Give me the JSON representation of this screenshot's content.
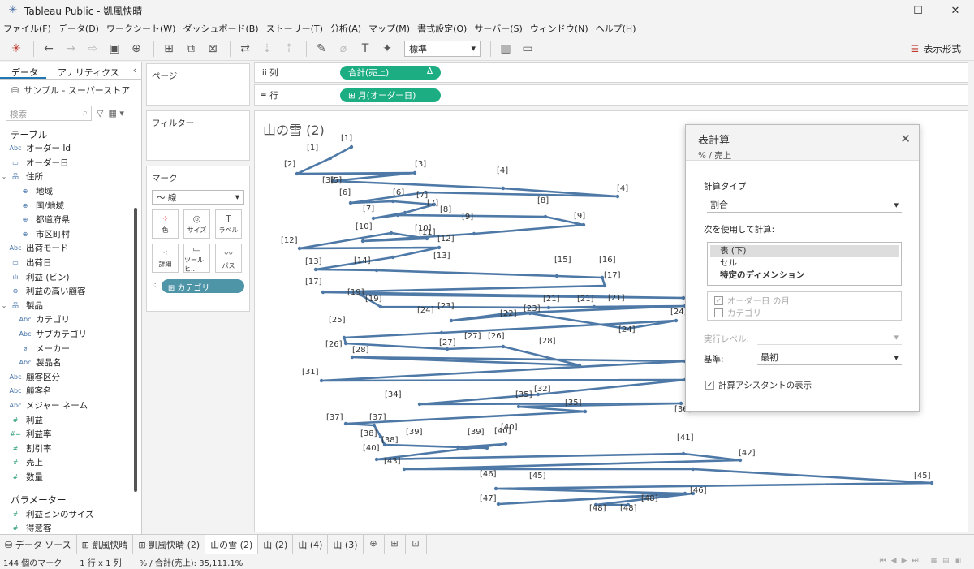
{
  "window": {
    "title": "Tableau Public - 凱風快晴"
  },
  "menu": [
    "ファイル(F)",
    "データ(D)",
    "ワークシート(W)",
    "ダッシュボード(B)",
    "ストーリー(T)",
    "分析(A)",
    "マップ(M)",
    "書式設定(O)",
    "サーバー(S)",
    "ウィンドウ(N)",
    "ヘルプ(H)"
  ],
  "toolbar": {
    "fit": "標準",
    "show_me": "表示形式"
  },
  "datapane": {
    "tab_data": "データ",
    "tab_analytics": "アナリティクス",
    "datasource": "サンプル - スーパーストア",
    "search_placeholder": "検索",
    "tables_header": "テーブル",
    "fields": [
      {
        "name": "オーダー Id",
        "icon": "Abc",
        "indent": 0
      },
      {
        "name": "オーダー日",
        "icon": "date",
        "indent": 0
      },
      {
        "name": "住所",
        "icon": "hier",
        "indent": 0,
        "expand": true
      },
      {
        "name": "地域",
        "icon": "geo",
        "indent": 1
      },
      {
        "name": "国/地域",
        "icon": "geo",
        "indent": 1
      },
      {
        "name": "都道府県",
        "icon": "geo",
        "indent": 1
      },
      {
        "name": "市区町村",
        "icon": "geo",
        "indent": 1
      },
      {
        "name": "出荷モード",
        "icon": "Abc",
        "indent": 0
      },
      {
        "name": "出荷日",
        "icon": "date",
        "indent": 0
      },
      {
        "name": "利益 (ビン)",
        "icon": "bin",
        "indent": 0
      },
      {
        "name": "利益の高い顧客",
        "icon": "set",
        "indent": 0
      },
      {
        "name": "製品",
        "icon": "hier",
        "indent": 0,
        "expand": true
      },
      {
        "name": "カテゴリ",
        "icon": "Abc",
        "indent": 1
      },
      {
        "name": "サブカテゴリ",
        "icon": "Abc",
        "indent": 1
      },
      {
        "name": "メーカー",
        "icon": "clip",
        "indent": 1
      },
      {
        "name": "製品名",
        "icon": "Abc",
        "indent": 1
      },
      {
        "name": "顧客区分",
        "icon": "Abc",
        "indent": 0
      },
      {
        "name": "顧客名",
        "icon": "Abc",
        "indent": 0
      },
      {
        "name": "メジャー ネーム",
        "icon": "Abc",
        "indent": 0
      },
      {
        "name": "利益",
        "icon": "#",
        "indent": 0
      },
      {
        "name": "利益率",
        "icon": "#=",
        "indent": 0
      },
      {
        "name": "割引率",
        "icon": "#",
        "indent": 0
      },
      {
        "name": "売上",
        "icon": "#",
        "indent": 0
      },
      {
        "name": "数量",
        "icon": "#",
        "indent": 0
      }
    ],
    "params_header": "パラメーター",
    "params": [
      "利益ビンのサイズ",
      "得意客"
    ]
  },
  "cards": {
    "pages": "ページ",
    "filters": "フィルター",
    "marks": "マーク",
    "mark_type": "線",
    "mark_buttons": [
      "色",
      "サイズ",
      "ラベル",
      "詳細",
      "ツールヒ...",
      "パス"
    ],
    "category_pill": "カテゴリ"
  },
  "shelves": {
    "columns_label": "列",
    "columns_pill": "合計(売上)",
    "columns_delta": "Δ",
    "rows_label": "行",
    "rows_pill": "月(オーダー日)"
  },
  "view": {
    "title": "山の雪 (2)"
  },
  "chart_data": {
    "type": "line",
    "labels_shown": true,
    "series_color": "#4e79a7",
    "labels": [
      "[1]",
      "[1]",
      "[2]",
      "[3]",
      "[3]",
      "[4]",
      "[4]",
      "[5]",
      "[6]",
      "[6]",
      "[7]",
      "[7]",
      "[7]",
      "[8]",
      "[8]",
      "[9]",
      "[9]",
      "[10]",
      "[10]",
      "[11]",
      "[12]",
      "[12]",
      "[13]",
      "[13]",
      "[14]",
      "[15]",
      "[16]",
      "[17]",
      "[17]",
      "[18]",
      "[19]",
      "[19]",
      "[21]",
      "[21]",
      "[21]",
      "[22]",
      "[23]",
      "[23]",
      "[24]",
      "[24]",
      "[24]",
      "[25]",
      "[26]",
      "[27]",
      "[27]",
      "[26]",
      "[28]",
      "[28]",
      "[31]",
      "[32]",
      "[34]",
      "[35]",
      "[35]",
      "[36]",
      "[37]",
      "[37]",
      "[38]",
      "[38]",
      "[39]",
      "[39]",
      "[40]",
      "[40]",
      "[40]",
      "[41]",
      "[42]",
      "[43]",
      "[45]",
      "[45]",
      "[46]",
      "[46]",
      "[47]",
      "[48]",
      "[48]",
      "[48]"
    ]
  },
  "dialog": {
    "title": "表計算",
    "subtitle": "% / 売上",
    "calc_type_label": "計算タイプ",
    "calc_type": "割合",
    "compute_using_label": "次を使用して計算:",
    "compute_options": [
      "表 (下)",
      "セル",
      "特定のディメンション"
    ],
    "dims": [
      "オーダー日 の月",
      "カテゴリ"
    ],
    "level_label": "実行レベル:",
    "base_label": "基準:",
    "base_value": "最初",
    "assistant": "計算アシスタントの表示"
  },
  "sheettabs": [
    "データ ソース",
    "凱風快晴",
    "凱風快晴 (2)",
    "山の雪 (2)",
    "山 (2)",
    "山 (4)",
    "山 (3)"
  ],
  "status": {
    "marks": "144 個のマーク",
    "dims": "1 行 x 1 列",
    "sum": "% / 合計(売上): 35,111.1%"
  }
}
